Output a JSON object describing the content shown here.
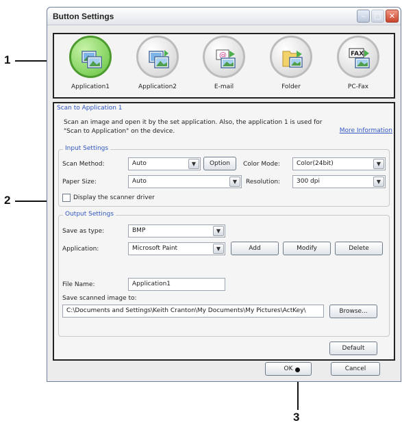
{
  "callouts": {
    "one": "1",
    "two": "2",
    "three": "3"
  },
  "window": {
    "title": "Button Settings",
    "tools": [
      {
        "label": "Application1",
        "icon": "application1-icon"
      },
      {
        "label": "Application2",
        "icon": "application2-icon"
      },
      {
        "label": "E-mail",
        "icon": "email-icon"
      },
      {
        "label": "Folder",
        "icon": "folder-icon"
      },
      {
        "label": "PC-Fax",
        "icon": "pc-fax-icon",
        "badge": "FAX"
      }
    ],
    "panel": {
      "title": "Scan to Application 1",
      "desc_line1": "Scan an image and open it by the set application. Also, the application 1 is used for",
      "desc_line2": "\"Scan to Application\" on the device.",
      "more_info": "More Information"
    },
    "input": {
      "group_label": "Input Settings",
      "scan_method_label": "Scan Method:",
      "scan_method_value": "Auto",
      "option_button": "Option",
      "color_mode_label": "Color Mode:",
      "color_mode_value": "Color(24bit)",
      "paper_size_label": "Paper Size:",
      "paper_size_value": "Auto",
      "resolution_label": "Resolution:",
      "resolution_value": "300 dpi",
      "display_driver_label": "Display the scanner driver"
    },
    "output": {
      "group_label": "Output Settings",
      "save_type_label": "Save as type:",
      "save_type_value": "BMP",
      "application_label": "Application:",
      "application_value": "Microsoft Paint",
      "add_button": "Add",
      "modify_button": "Modify",
      "delete_button": "Delete",
      "file_name_label": "File Name:",
      "file_name_value": "Application1",
      "save_to_label": "Save scanned image to:",
      "save_to_value": "C:\\Documents and Settings\\Keith Cranton\\My Documents\\My Pictures\\ActKey\\",
      "browse_button": "Browse..."
    },
    "default_button": "Default",
    "ok_button": "OK",
    "cancel_button": "Cancel"
  }
}
